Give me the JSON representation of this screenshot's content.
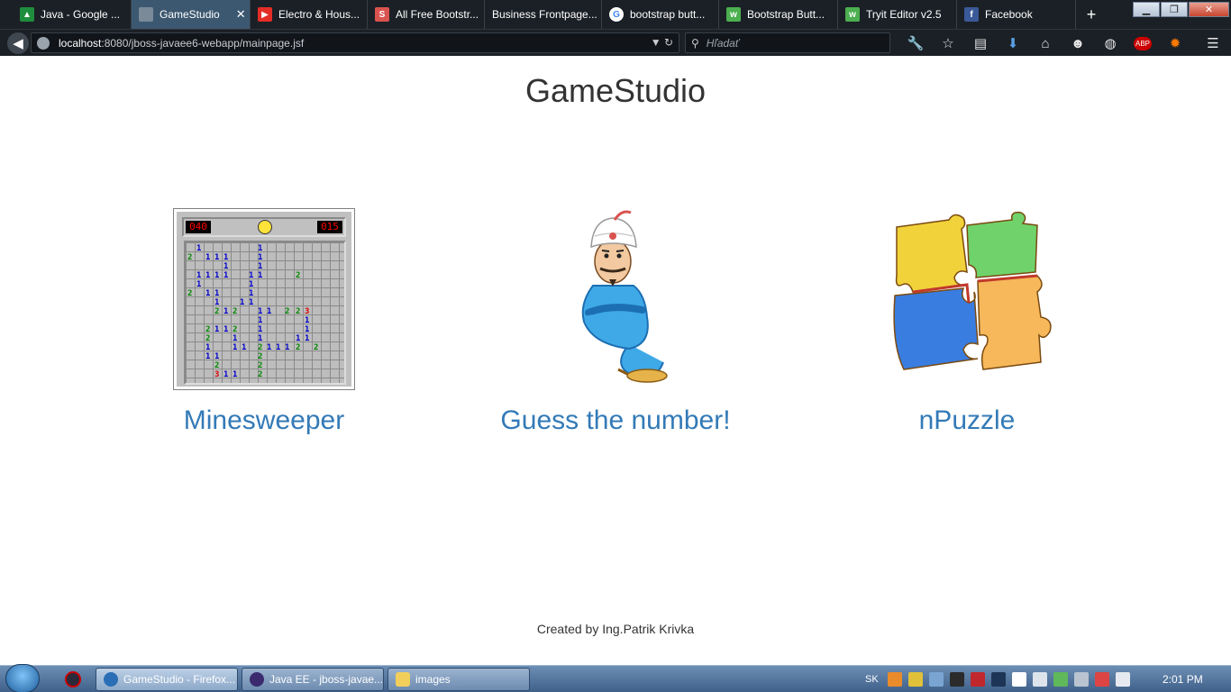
{
  "browser": {
    "tabs": [
      {
        "label": "Java - Google ...",
        "icon": "google-drive-icon",
        "color": "#1e8e3e"
      },
      {
        "label": "GameStudio",
        "icon": "page-icon",
        "color": "#7a8a99",
        "active": true
      },
      {
        "label": "Electro & Hous...",
        "icon": "youtube-icon",
        "color": "#e52d27"
      },
      {
        "label": "All Free Bootstr...",
        "icon": "s-icon",
        "color": "#d9534f"
      },
      {
        "label": "Business Frontpage...",
        "icon": "none",
        "color": ""
      },
      {
        "label": "bootstrap butt...",
        "icon": "google-icon",
        "color": "#4285f4"
      },
      {
        "label": "Bootstrap Butt...",
        "icon": "w3-icon",
        "color": "#4caf50"
      },
      {
        "label": "Tryit Editor v2.5",
        "icon": "w3-icon",
        "color": "#4caf50"
      },
      {
        "label": "Facebook",
        "icon": "facebook-icon",
        "color": "#3b5998"
      }
    ],
    "tab_close_symbol": "✕",
    "new_tab_symbol": "+",
    "url_host": "localhost",
    "url_rest": ":8080/jboss-javaee6-webapp/mainpage.jsf",
    "search_placeholder": "Hľadať"
  },
  "page": {
    "title": "GameStudio",
    "games": [
      {
        "label": "Minesweeper",
        "image": "minesweeper-board"
      },
      {
        "label": "Guess the number!",
        "image": "genie-character"
      },
      {
        "label": "nPuzzle",
        "image": "jigsaw-puzzle-pieces"
      }
    ],
    "minesweeper_counter_left": "040",
    "minesweeper_counter_right": "015",
    "footer": "Created by Ing.Patrik Krivka"
  },
  "taskbar": {
    "items": [
      {
        "label": "GameStudio - Firefox...",
        "active": true
      },
      {
        "label": "Java EE - jboss-javae..."
      },
      {
        "label": "images"
      }
    ],
    "language": "SK",
    "clock": "2:01 PM"
  },
  "colors": {
    "link": "#337ab7",
    "title": "#333333"
  }
}
